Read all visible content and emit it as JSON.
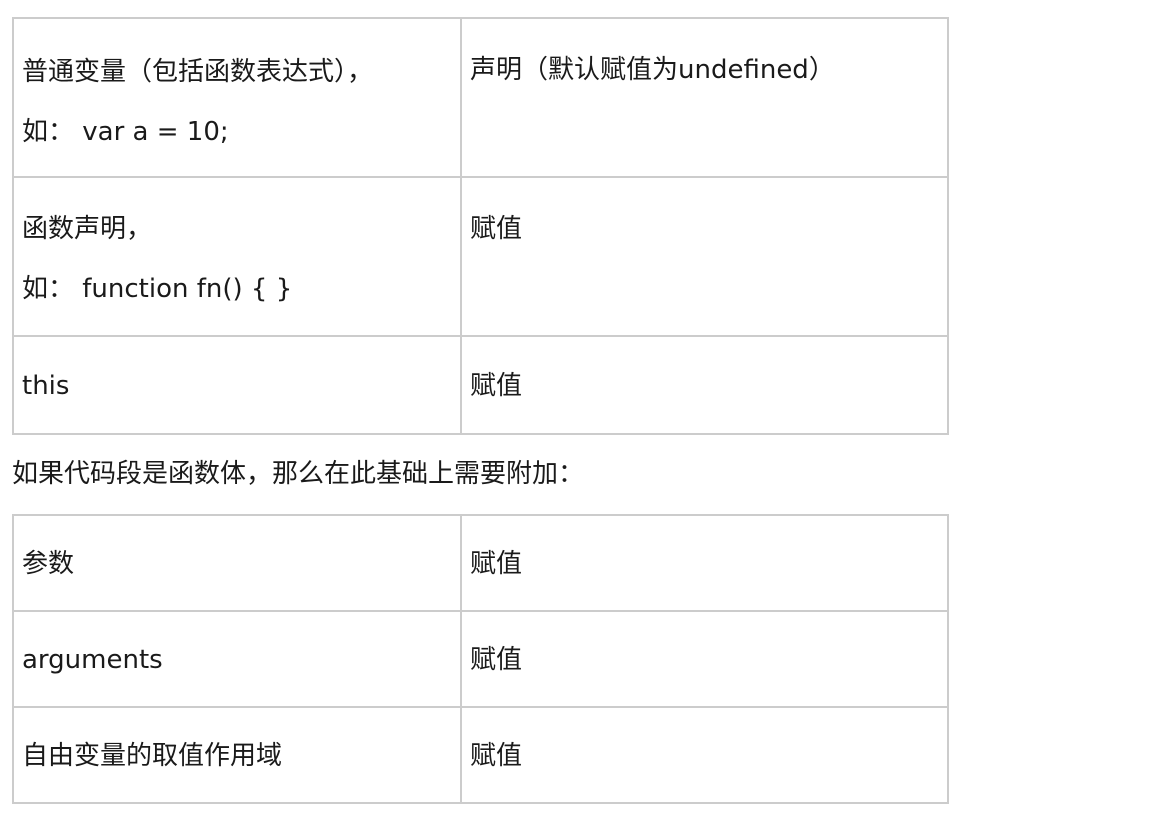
{
  "table1": {
    "rows": [
      {
        "left": [
          "普通变量（包括函数表达式），",
          "如：  var a = 10;"
        ],
        "right": "声明（默认赋值为undefined）"
      },
      {
        "left": [
          "函数声明，",
          "如：  function fn() { }"
        ],
        "right": "赋值"
      },
      {
        "left": [
          "this"
        ],
        "right": "赋值"
      }
    ]
  },
  "paragraph": "如果代码段是函数体，那么在此基础上需要附加：",
  "table2": {
    "rows": [
      {
        "left": "参数",
        "right": "赋值"
      },
      {
        "left": "arguments",
        "right": "赋值"
      },
      {
        "left": "自由变量的取值作用域",
        "right": "赋值"
      }
    ]
  }
}
